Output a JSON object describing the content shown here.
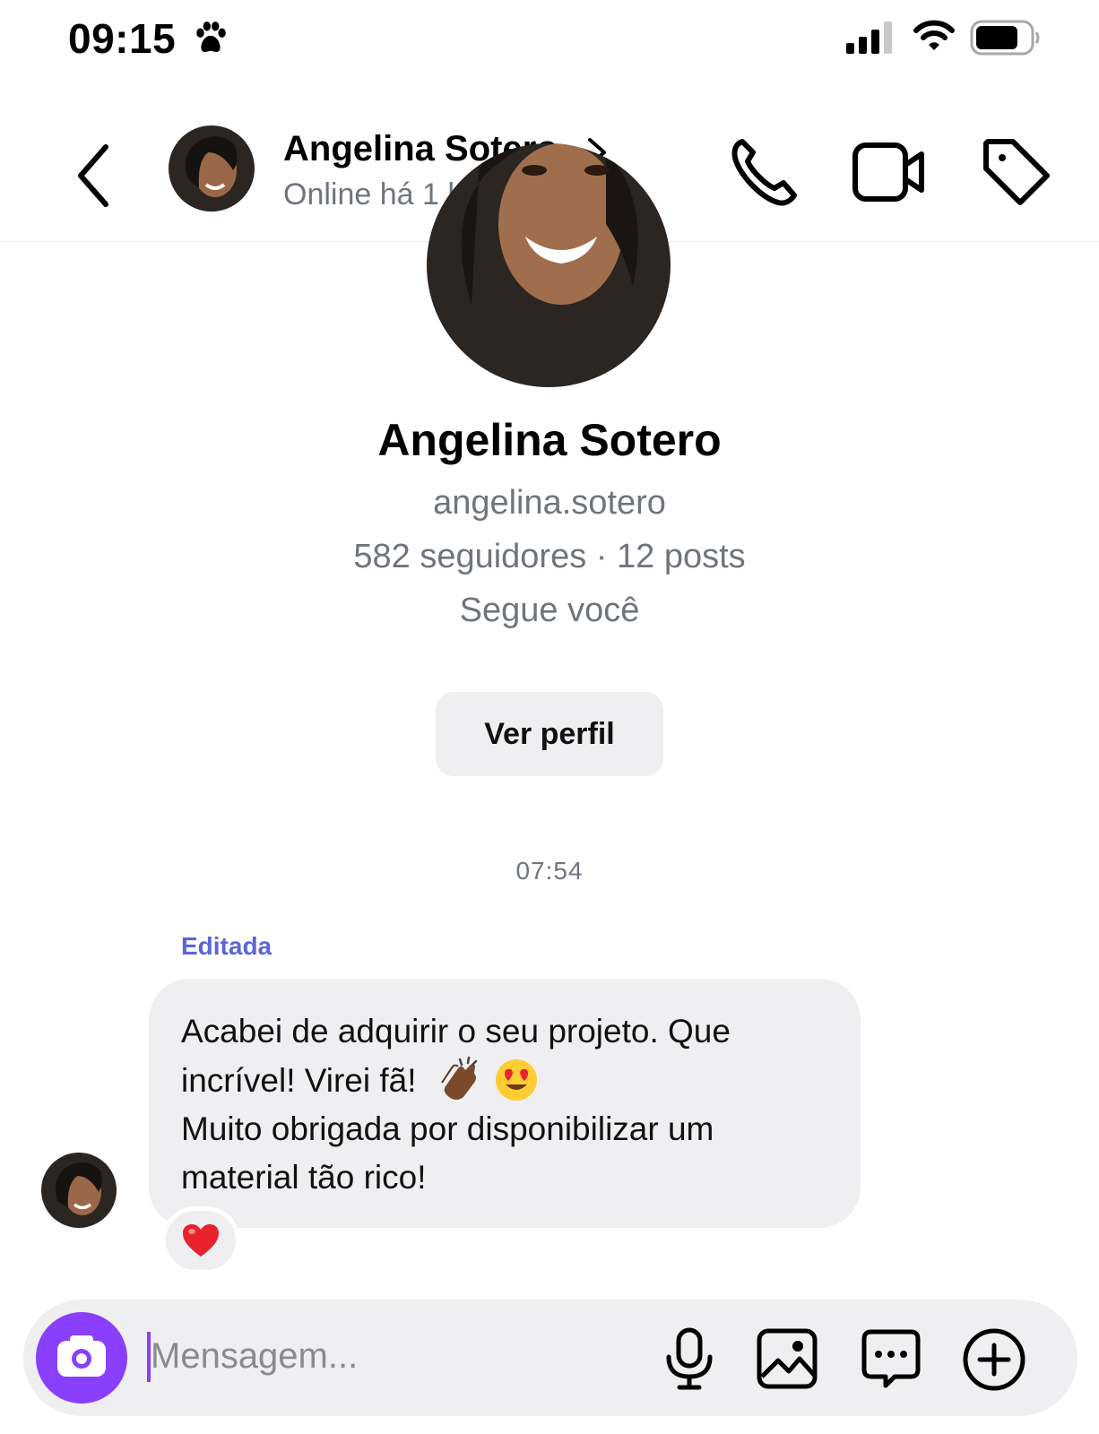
{
  "status_bar": {
    "time": "09:15"
  },
  "header": {
    "name": "Angelina Sotero",
    "status": "Online há 1 h"
  },
  "profile": {
    "name": "Angelina Sotero",
    "username": "angelina.sotero",
    "stats": "582 seguidores · 12 posts",
    "follows": "Segue você",
    "view_profile_label": "Ver perfil"
  },
  "chat": {
    "timestamp": "07:54",
    "edited_label": "Editada",
    "message_lines": [
      "Acabei de adquirir o seu projeto. Que",
      "incrível! Virei fã!",
      "Muito obrigada por disponibilizar um",
      "material tão rico!"
    ],
    "reaction": "heart"
  },
  "composer": {
    "placeholder": "Mensagem..."
  },
  "colors": {
    "accent": "#8a3ffc",
    "edited": "#5b66d9",
    "bubble": "#efeff2",
    "muted_text": "#70757c"
  }
}
